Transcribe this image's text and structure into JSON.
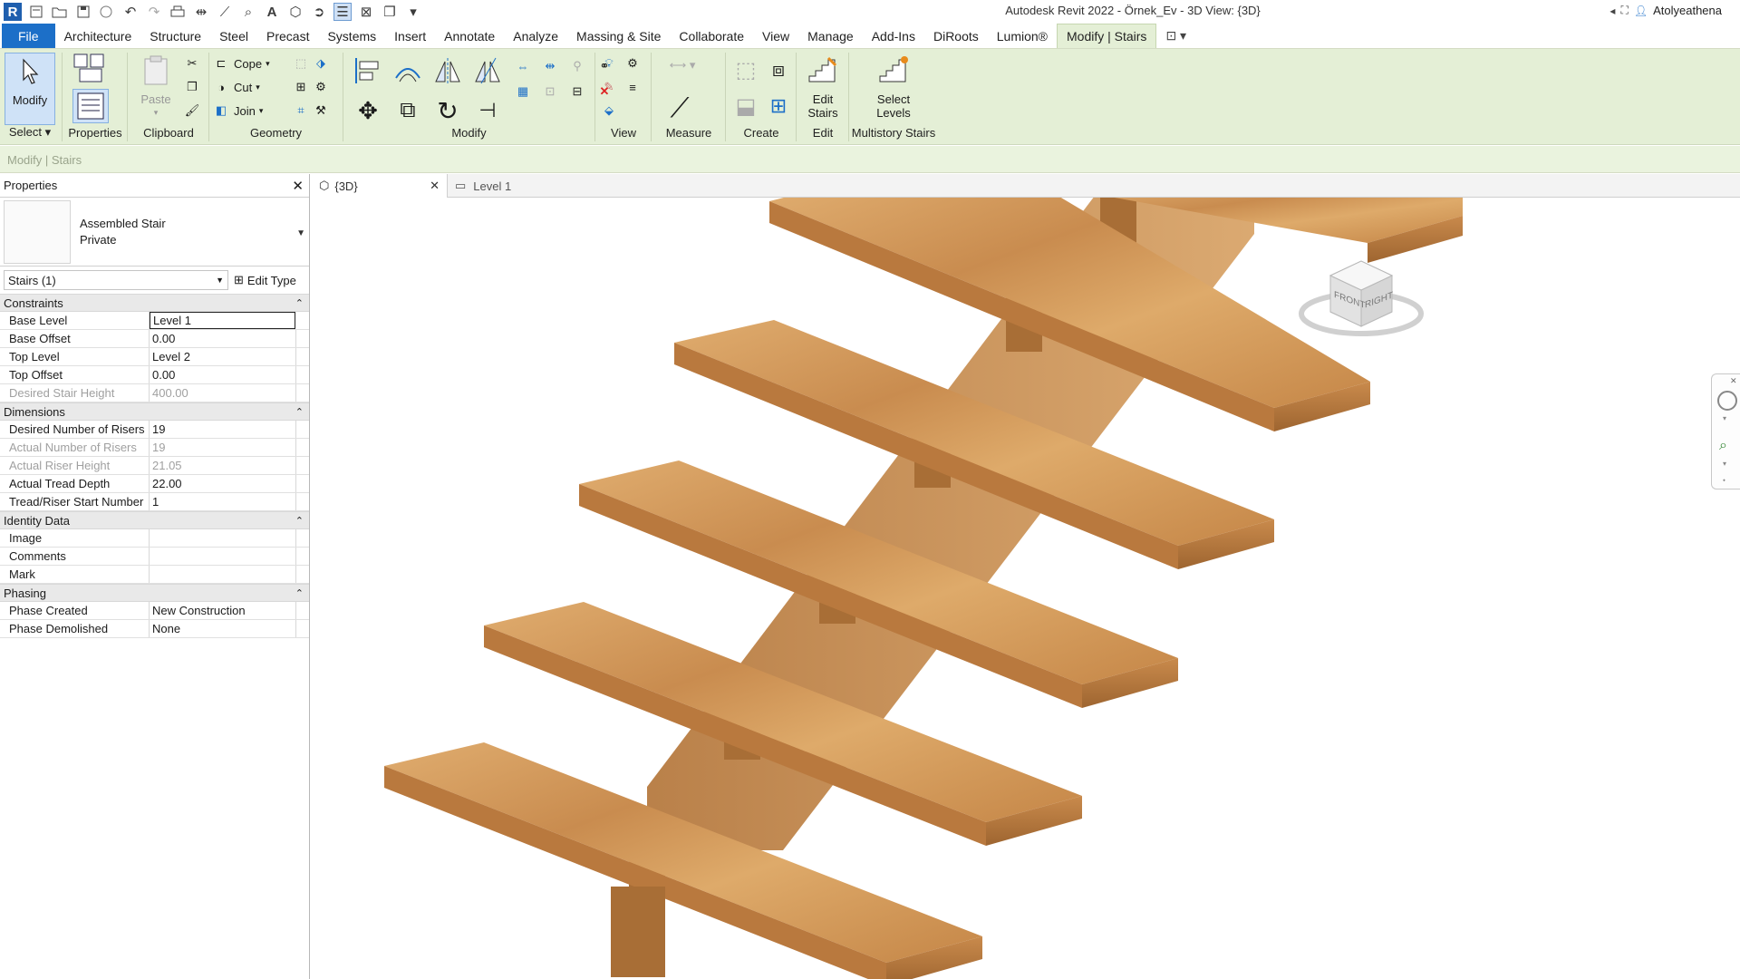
{
  "titlebar": {
    "title": "Autodesk Revit 2022 - Örnek_Ev - 3D View: {3D}",
    "user": "Atolyeathena",
    "qat_icons": [
      "revit-logo-icon",
      "open-icon",
      "open-folder-icon",
      "save-icon",
      "sync-icon",
      "undo-icon",
      "redo-icon",
      "print-icon",
      "measure-icon",
      "dimension-icon",
      "tag-icon",
      "text-icon",
      "3d-view-icon",
      "section-icon",
      "thin-lines-icon",
      "close-hidden-icon",
      "switch-windows-icon",
      "customize-icon"
    ]
  },
  "menu": {
    "file": "File",
    "tabs": [
      "Architecture",
      "Structure",
      "Steel",
      "Precast",
      "Systems",
      "Insert",
      "Annotate",
      "Analyze",
      "Massing & Site",
      "Collaborate",
      "View",
      "Manage",
      "Add-Ins",
      "DiRoots",
      "Lumion®"
    ],
    "active_tab": "Modify | Stairs"
  },
  "ribbon": {
    "select": {
      "modify_label": "Modify",
      "panel_label": "Select"
    },
    "properties": {
      "panel_label": "Properties"
    },
    "clipboard": {
      "paste_label": "Paste",
      "panel_label": "Clipboard"
    },
    "geometry": {
      "cope": "Cope",
      "cut": "Cut",
      "join": "Join",
      "panel_label": "Geometry"
    },
    "modify": {
      "panel_label": "Modify"
    },
    "view": {
      "panel_label": "View"
    },
    "measure": {
      "panel_label": "Measure"
    },
    "create": {
      "panel_label": "Create"
    },
    "edit": {
      "edit_stairs_line1": "Edit",
      "edit_stairs_line2": "Stairs",
      "panel_label": "Edit"
    },
    "multistory": {
      "select_levels_line1": "Select",
      "select_levels_line2": "Levels",
      "panel_label": "Multistory Stairs"
    }
  },
  "options_bar": {
    "context": "Modify | Stairs"
  },
  "properties": {
    "title": "Properties",
    "type_family": "Assembled Stair",
    "type_name": "Private",
    "filter": "Stairs (1)",
    "edit_type": "Edit Type",
    "groups": [
      {
        "name": "Constraints",
        "rows": [
          {
            "name": "Base Level",
            "value": "Level 1",
            "disabled": false,
            "editing": true
          },
          {
            "name": "Base Offset",
            "value": "0.00",
            "disabled": false
          },
          {
            "name": "Top Level",
            "value": "Level 2",
            "disabled": false
          },
          {
            "name": "Top Offset",
            "value": "0.00",
            "disabled": false
          },
          {
            "name": "Desired Stair Height",
            "value": "400.00",
            "disabled": true
          }
        ]
      },
      {
        "name": "Dimensions",
        "rows": [
          {
            "name": "Desired Number of Risers",
            "value": "19",
            "disabled": false
          },
          {
            "name": "Actual Number of Risers",
            "value": "19",
            "disabled": true
          },
          {
            "name": "Actual Riser Height",
            "value": "21.05",
            "disabled": true
          },
          {
            "name": "Actual Tread Depth",
            "value": "22.00",
            "disabled": false
          },
          {
            "name": "Tread/Riser Start Number",
            "value": "1",
            "disabled": false
          }
        ]
      },
      {
        "name": "Identity Data",
        "rows": [
          {
            "name": "Image",
            "value": "",
            "disabled": false
          },
          {
            "name": "Comments",
            "value": "",
            "disabled": false
          },
          {
            "name": "Mark",
            "value": "",
            "disabled": false
          }
        ]
      },
      {
        "name": "Phasing",
        "rows": [
          {
            "name": "Phase Created",
            "value": "New Construction",
            "disabled": false
          },
          {
            "name": "Phase Demolished",
            "value": "None",
            "disabled": false
          }
        ]
      }
    ]
  },
  "view_tabs": [
    {
      "label": "{3D}",
      "active": true
    },
    {
      "label": "Level 1",
      "active": false
    }
  ],
  "viewcube": {
    "front": "FRONT",
    "right": "RIGHT"
  },
  "colors": {
    "ribbon_bg": "#e4efd6",
    "file_tab": "#1c6fc8",
    "wood_top": "#d39a5a",
    "wood_edge": "#b0723a",
    "stringer": "#c8884a"
  }
}
